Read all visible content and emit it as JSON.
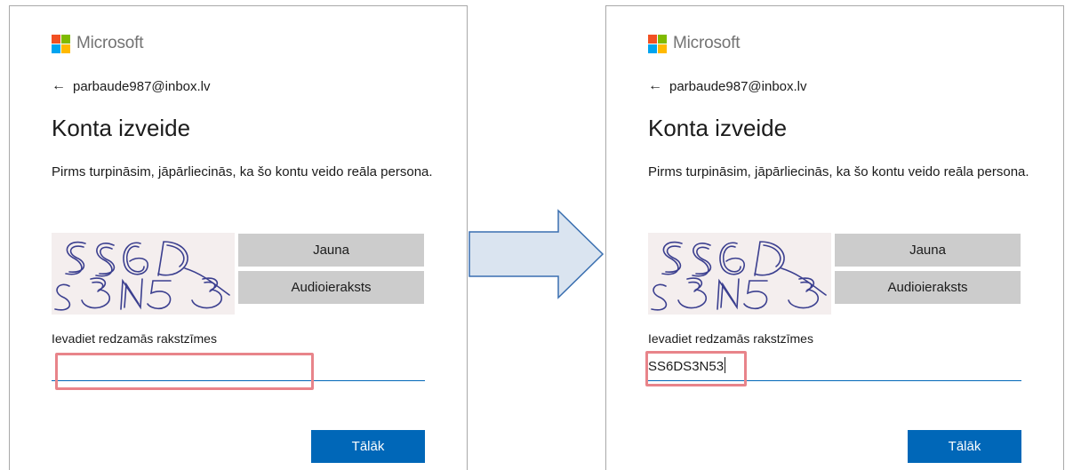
{
  "colors": {
    "accent": "#0067b8",
    "highlight": "#e8848a",
    "captcha_stroke": "#3b3f8f",
    "arrow_fill": "#dae4f0",
    "arrow_stroke": "#3a6fb0"
  },
  "panels": [
    {
      "logo_text": "Microsoft",
      "identity": {
        "back_icon": "←",
        "email": "parbaude987@inbox.lv"
      },
      "title": "Konta izveide",
      "description": "Pirms turpināsim, jāpārliecinās, ka šo kontu veido reāla persona.",
      "captcha": {
        "text": "SS6DS3N53",
        "new_label": "Jauna",
        "audio_label": "Audioieraksts"
      },
      "input_label": "Ievadiet redzamās rakstzīmes",
      "input_value": "",
      "next_label": "Tālāk"
    },
    {
      "logo_text": "Microsoft",
      "identity": {
        "back_icon": "←",
        "email": "parbaude987@inbox.lv"
      },
      "title": "Konta izveide",
      "description": "Pirms turpināsim, jāpārliecinās, ka šo kontu veido reāla persona.",
      "captcha": {
        "text": "SS6DS3N53",
        "new_label": "Jauna",
        "audio_label": "Audioieraksts"
      },
      "input_label": "Ievadiet redzamās rakstzīmes",
      "input_value": "SS6DS3N53",
      "next_label": "Tālāk"
    }
  ]
}
